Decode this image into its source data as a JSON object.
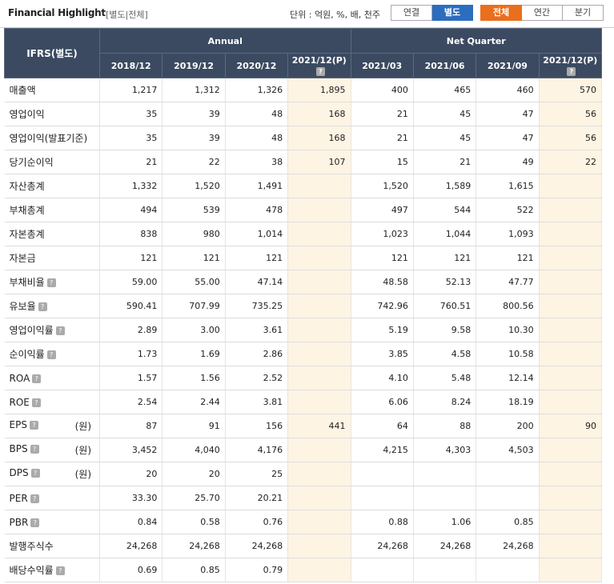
{
  "header": {
    "title": "Financial Highlight",
    "subtitle": "[별도|전체]",
    "unit_text": "단위 : 억원, %, 배, 천주",
    "toggle1": [
      "연결",
      "별도"
    ],
    "toggle1_active": "별도",
    "toggle2": [
      "전체",
      "연간",
      "분기"
    ],
    "toggle2_active": "전체"
  },
  "table": {
    "item_header": "IFRS(별도)",
    "annual_header": "Annual",
    "quarter_header": "Net Quarter",
    "columns": [
      "2018/12",
      "2019/12",
      "2020/12",
      "2021/12(P)",
      "2021/03",
      "2021/06",
      "2021/09",
      "2021/12(P)"
    ],
    "rows": [
      {
        "label": "매출액",
        "help": false,
        "unit": "",
        "values": [
          "1,217",
          "1,312",
          "1,326",
          "1,895",
          "400",
          "465",
          "460",
          "570"
        ]
      },
      {
        "label": "영업이익",
        "help": false,
        "unit": "",
        "values": [
          "35",
          "39",
          "48",
          "168",
          "21",
          "45",
          "47",
          "56"
        ]
      },
      {
        "label": "영업이익(발표기준)",
        "help": false,
        "unit": "",
        "values": [
          "35",
          "39",
          "48",
          "168",
          "21",
          "45",
          "47",
          "56"
        ]
      },
      {
        "label": "당기순이익",
        "help": false,
        "unit": "",
        "values": [
          "21",
          "22",
          "38",
          "107",
          "15",
          "21",
          "49",
          "22"
        ]
      },
      {
        "label": "자산총계",
        "help": false,
        "unit": "",
        "values": [
          "1,332",
          "1,520",
          "1,491",
          "",
          "1,520",
          "1,589",
          "1,615",
          ""
        ]
      },
      {
        "label": "부채총계",
        "help": false,
        "unit": "",
        "values": [
          "494",
          "539",
          "478",
          "",
          "497",
          "544",
          "522",
          ""
        ]
      },
      {
        "label": "자본총계",
        "help": false,
        "unit": "",
        "values": [
          "838",
          "980",
          "1,014",
          "",
          "1,023",
          "1,044",
          "1,093",
          ""
        ]
      },
      {
        "label": "자본금",
        "help": false,
        "unit": "",
        "values": [
          "121",
          "121",
          "121",
          "",
          "121",
          "121",
          "121",
          ""
        ]
      },
      {
        "label": "부채비율",
        "help": true,
        "unit": "",
        "values": [
          "59.00",
          "55.00",
          "47.14",
          "",
          "48.58",
          "52.13",
          "47.77",
          ""
        ]
      },
      {
        "label": "유보율",
        "help": true,
        "unit": "",
        "values": [
          "590.41",
          "707.99",
          "735.25",
          "",
          "742.96",
          "760.51",
          "800.56",
          ""
        ]
      },
      {
        "label": "영업이익률",
        "help": true,
        "unit": "",
        "values": [
          "2.89",
          "3.00",
          "3.61",
          "",
          "5.19",
          "9.58",
          "10.30",
          ""
        ]
      },
      {
        "label": "순이익률",
        "help": true,
        "unit": "",
        "values": [
          "1.73",
          "1.69",
          "2.86",
          "",
          "3.85",
          "4.58",
          "10.58",
          ""
        ]
      },
      {
        "label": "ROA",
        "help": true,
        "unit": "",
        "values": [
          "1.57",
          "1.56",
          "2.52",
          "",
          "4.10",
          "5.48",
          "12.14",
          ""
        ]
      },
      {
        "label": "ROE",
        "help": true,
        "unit": "",
        "values": [
          "2.54",
          "2.44",
          "3.81",
          "",
          "6.06",
          "8.24",
          "18.19",
          ""
        ]
      },
      {
        "label": "EPS",
        "help": true,
        "unit": "(원)",
        "values": [
          "87",
          "91",
          "156",
          "441",
          "64",
          "88",
          "200",
          "90"
        ]
      },
      {
        "label": "BPS",
        "help": true,
        "unit": "(원)",
        "values": [
          "3,452",
          "4,040",
          "4,176",
          "",
          "4,215",
          "4,303",
          "4,503",
          ""
        ]
      },
      {
        "label": "DPS",
        "help": true,
        "unit": "(원)",
        "values": [
          "20",
          "20",
          "25",
          "",
          "",
          "",
          "",
          ""
        ]
      },
      {
        "label": "PER",
        "help": true,
        "unit": "",
        "values": [
          "33.30",
          "25.70",
          "20.21",
          "",
          "",
          "",
          "",
          ""
        ]
      },
      {
        "label": "PBR",
        "help": true,
        "unit": "",
        "values": [
          "0.84",
          "0.58",
          "0.76",
          "",
          "0.88",
          "1.06",
          "0.85",
          ""
        ]
      },
      {
        "label": "발행주식수",
        "help": false,
        "unit": "",
        "values": [
          "24,268",
          "24,268",
          "24,268",
          "",
          "24,268",
          "24,268",
          "24,268",
          ""
        ]
      },
      {
        "label": "배당수익률",
        "help": true,
        "unit": "",
        "values": [
          "0.69",
          "0.85",
          "0.79",
          "",
          "",
          "",
          "",
          ""
        ]
      }
    ]
  }
}
